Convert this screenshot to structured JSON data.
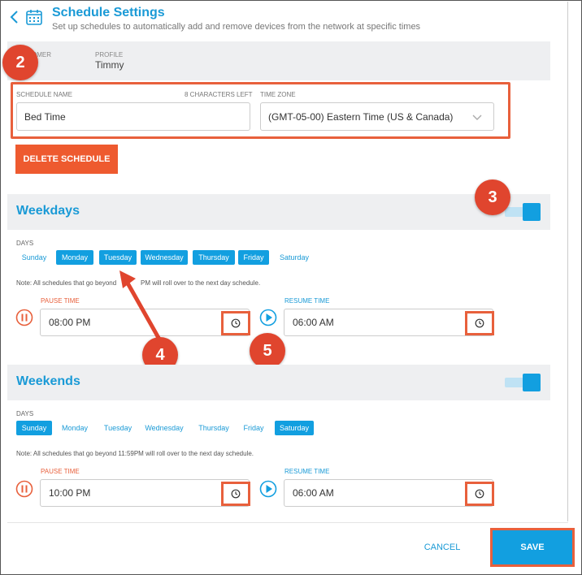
{
  "header": {
    "title": "Schedule Settings",
    "subtitle": "Set up schedules to automatically add and remove devices from the network at specific times"
  },
  "info": {
    "customer_label": "OMER",
    "customer_value": "e",
    "profile_label": "PROFILE",
    "profile_value": "Timmy"
  },
  "form": {
    "schedule_name_label": "SCHEDULE NAME",
    "chars_left": "8  CHARACTERS LEFT",
    "schedule_name_value": "Bed Time",
    "timezone_label": "TIME ZONE",
    "timezone_value": "(GMT-05-00) Eastern Time (US & Canada)",
    "delete_label": "DELETE SCHEDULE"
  },
  "callouts": {
    "c2": "2",
    "c3": "3",
    "c4": "4",
    "c5": "5"
  },
  "weekdays": {
    "title": "Weekdays",
    "days_label": "DAYS",
    "days": [
      {
        "label": "Sunday",
        "on": false
      },
      {
        "label": "Monday",
        "on": true
      },
      {
        "label": "Tuesday",
        "on": true
      },
      {
        "label": "Wednesday",
        "on": true
      },
      {
        "label": "Thursday",
        "on": true
      },
      {
        "label": "Friday",
        "on": true
      },
      {
        "label": "Saturday",
        "on": false
      }
    ],
    "note_left": "Note: All schedules that go beyond",
    "note_right": "PM will roll over to the next day schedule.",
    "pause_label": "PAUSE TIME",
    "pause_value": "08:00 PM",
    "resume_label": "RESUME TIME",
    "resume_value": "06:00 AM",
    "enabled": true
  },
  "weekends": {
    "title": "Weekends",
    "days_label": "DAYS",
    "days": [
      {
        "label": "Sunday",
        "on": true
      },
      {
        "label": "Monday",
        "on": false
      },
      {
        "label": "Tuesday",
        "on": false
      },
      {
        "label": "Wednesday",
        "on": false
      },
      {
        "label": "Thursday",
        "on": false
      },
      {
        "label": "Friday",
        "on": false
      },
      {
        "label": "Saturday",
        "on": true
      }
    ],
    "note": "Note: All schedules that go beyond 11:59PM will roll over to the next day schedule.",
    "pause_label": "PAUSE TIME",
    "pause_value": "10:00 PM",
    "resume_label": "RESUME TIME",
    "resume_value": "06:00 AM",
    "enabled": true
  },
  "footer": {
    "cancel_label": "CANCEL",
    "save_label": "SAVE"
  },
  "colors": {
    "accent": "#129fe0",
    "highlight": "#e8603c",
    "callout": "#e0452e"
  },
  "icons": [
    "back-chevron-icon",
    "calendar-icon",
    "pause-icon",
    "play-icon",
    "clock-icon",
    "chevron-down-icon"
  ]
}
